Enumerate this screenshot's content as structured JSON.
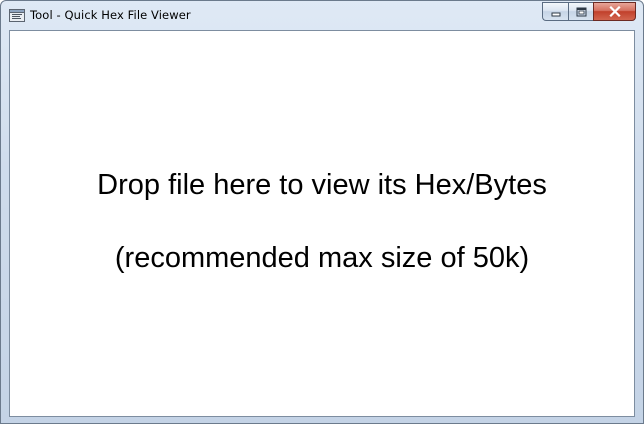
{
  "window": {
    "title": "Tool - Quick Hex File Viewer",
    "icons": {
      "app": "app-window-icon",
      "minimize": "minimize-icon",
      "maximize": "maximize-icon",
      "close": "close-icon"
    }
  },
  "content": {
    "drop_message": "Drop file here to view its Hex/Bytes",
    "size_hint": "(recommended max size of 50k)"
  },
  "colors": {
    "close_button": "#c1402b",
    "client_background": "#ffffff",
    "frame": "#cfdcec"
  }
}
